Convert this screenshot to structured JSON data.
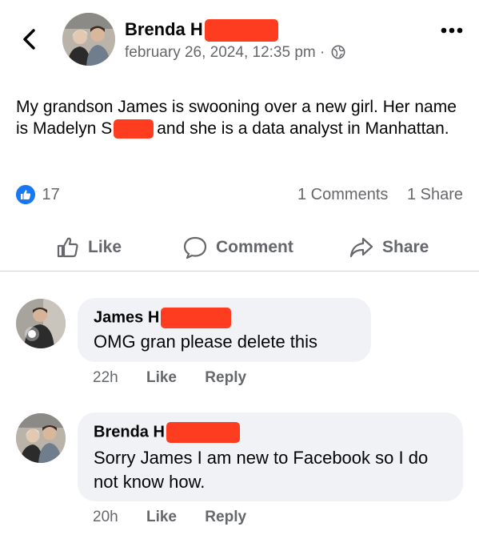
{
  "post": {
    "author": "Brenda H",
    "timestamp": "february 26, 2024, 12:35 pm",
    "separator": "·",
    "text": {
      "part1": "My grandson James is swooning over a new girl. Her name is Madelyn S",
      "part2": "and she is a data analyst in Manhattan."
    },
    "reaction_count": "17",
    "comments_count": "1 Comments",
    "shares_count": "1 Share"
  },
  "actions": {
    "like": "Like",
    "comment": "Comment",
    "share": "Share"
  },
  "comments": [
    {
      "author": "James H",
      "text": "OMG gran please delete this",
      "time": "22h",
      "like": "Like",
      "reply": "Reply"
    },
    {
      "author": "Brenda H",
      "text": "Sorry James I am new to Facebook so I do not know how.",
      "time": "20h",
      "like": "Like",
      "reply": "Reply"
    }
  ],
  "colors": {
    "accent": "#1877f2",
    "muted_text": "#65676b",
    "bubble": "#f0f2f5",
    "redaction": "#fe3c1f"
  },
  "icons": [
    "back-chevron-icon",
    "more-dots-icon",
    "globe-icon",
    "like-reaction-icon",
    "thumbs-up-icon",
    "comment-bubble-icon",
    "share-arrow-icon"
  ]
}
